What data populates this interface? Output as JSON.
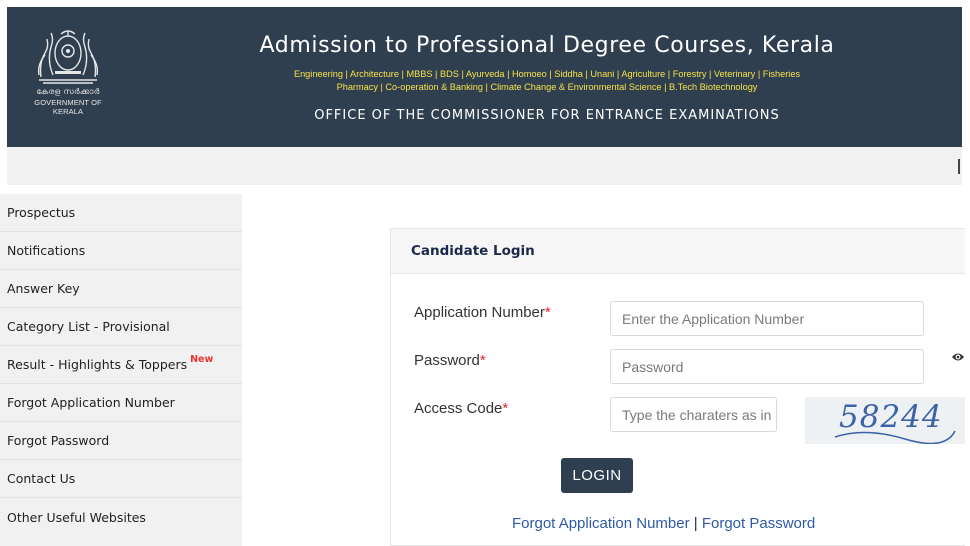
{
  "header": {
    "emblem_text_ml": "കേരള സർക്കാർ",
    "emblem_text_en": "GOVERNMENT OF KERALA",
    "title": "Admission to Professional Degree Courses, Kerala",
    "courses_line1": "Engineering | Architecture | MBBS | BDS | Ayurveda | Homoeo | Siddha | Unani | Agriculture | Forestry | Veterinary | Fisheries",
    "courses_line2": "Pharmacy | Co-operation & Banking | Climate Change & Environmental Science | B.Tech Biotechnology",
    "office": "OFFICE OF THE COMMISSIONER FOR ENTRANCE EXAMINATIONS"
  },
  "sidebar": {
    "items": [
      {
        "label": "Prospectus"
      },
      {
        "label": "Notifications"
      },
      {
        "label": "Answer Key"
      },
      {
        "label": "Category List - Provisional"
      },
      {
        "label": "Result - Highlights & Toppers",
        "badge": "New"
      },
      {
        "label": "Forgot Application Number"
      },
      {
        "label": "Forgot Password"
      },
      {
        "label": "Contact Us"
      },
      {
        "label": "Other Useful Websites"
      }
    ]
  },
  "login": {
    "heading": "Candidate Login",
    "app_number_label": "Application Number",
    "app_number_placeholder": "Enter the Application Number",
    "password_label": "Password",
    "password_placeholder": "Password",
    "access_code_label": "Access Code",
    "access_code_placeholder": "Type the charaters as in image",
    "required_mark": "*",
    "captcha_text": "58244",
    "login_button": "LOGIN",
    "forgot_app_number": "Forgot Application Number",
    "separator": "|",
    "forgot_password": "Forgot Password"
  },
  "colors": {
    "header_bg": "#2f3f50",
    "courses_text": "#f5e24a",
    "required": "#e0242f",
    "link": "#2e5aa8",
    "new_badge": "#ee3333"
  }
}
